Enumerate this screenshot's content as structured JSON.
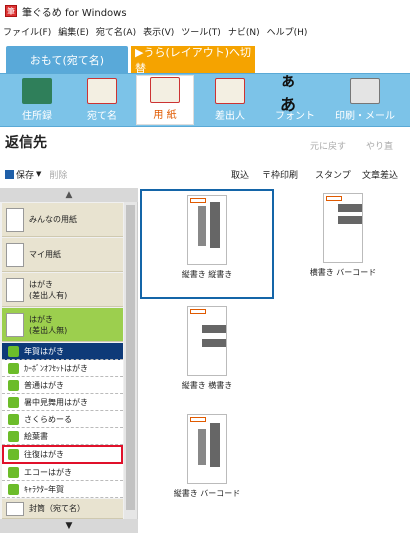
{
  "window": {
    "title": "筆ぐるめ for Windows"
  },
  "menu": [
    "ファイル(F)",
    "編集(E)",
    "宛て名(A)",
    "表示(V)",
    "ツール(T)",
    "ナビ(N)",
    "ヘルプ(H)"
  ],
  "mode_tabs": {
    "front": "おもて(宛て名)",
    "back": "▶うら(レイアウト)へ切替"
  },
  "toolbar": [
    {
      "label": "住所録",
      "icon": "address-book-icon"
    },
    {
      "label": "宛て名",
      "icon": "addressee-icon"
    },
    {
      "label": "用 紙",
      "icon": "paper-icon"
    },
    {
      "label": "差出人",
      "icon": "sender-icon"
    },
    {
      "label": "フォント",
      "icon": "font-icon"
    },
    {
      "label": "印刷・メール",
      "icon": "printer-icon"
    }
  ],
  "section": {
    "title": "返信先",
    "undo": "元に戻す",
    "redo": "やり直"
  },
  "actions": {
    "save": "保存",
    "delete": "削除",
    "take": "取込",
    "frame_print": "〒枠印刷",
    "stamp": "スタンプ",
    "insert": "文章差込"
  },
  "categories": [
    {
      "label": "みんなの用紙"
    },
    {
      "label": "マイ用紙"
    },
    {
      "label": "はがき\n(差出人有)"
    },
    {
      "label": "はがき\n(差出人無)"
    }
  ],
  "items": [
    {
      "label": "年賀はがき"
    },
    {
      "label": "ｶｰﾎﾞﾝｵﾌｾｯﾄはがき"
    },
    {
      "label": "普通はがき"
    },
    {
      "label": "暑中見舞用はがき"
    },
    {
      "label": "さくらめーる"
    },
    {
      "label": "絵葉書"
    },
    {
      "label": "往復はがき"
    },
    {
      "label": "エコーはがき"
    },
    {
      "label": "ｷｬﾗｸﾀｰ年賀"
    }
  ],
  "bottom_category": {
    "label": "封筒（宛て名）"
  },
  "scroll": {
    "up": "▲",
    "down": "▼"
  },
  "papers": [
    {
      "label": "縦書き 縦書き"
    },
    {
      "label": "横書き バーコード"
    },
    {
      "label": "縦書き 横書き"
    },
    {
      "label": "縦書き バーコード"
    }
  ]
}
